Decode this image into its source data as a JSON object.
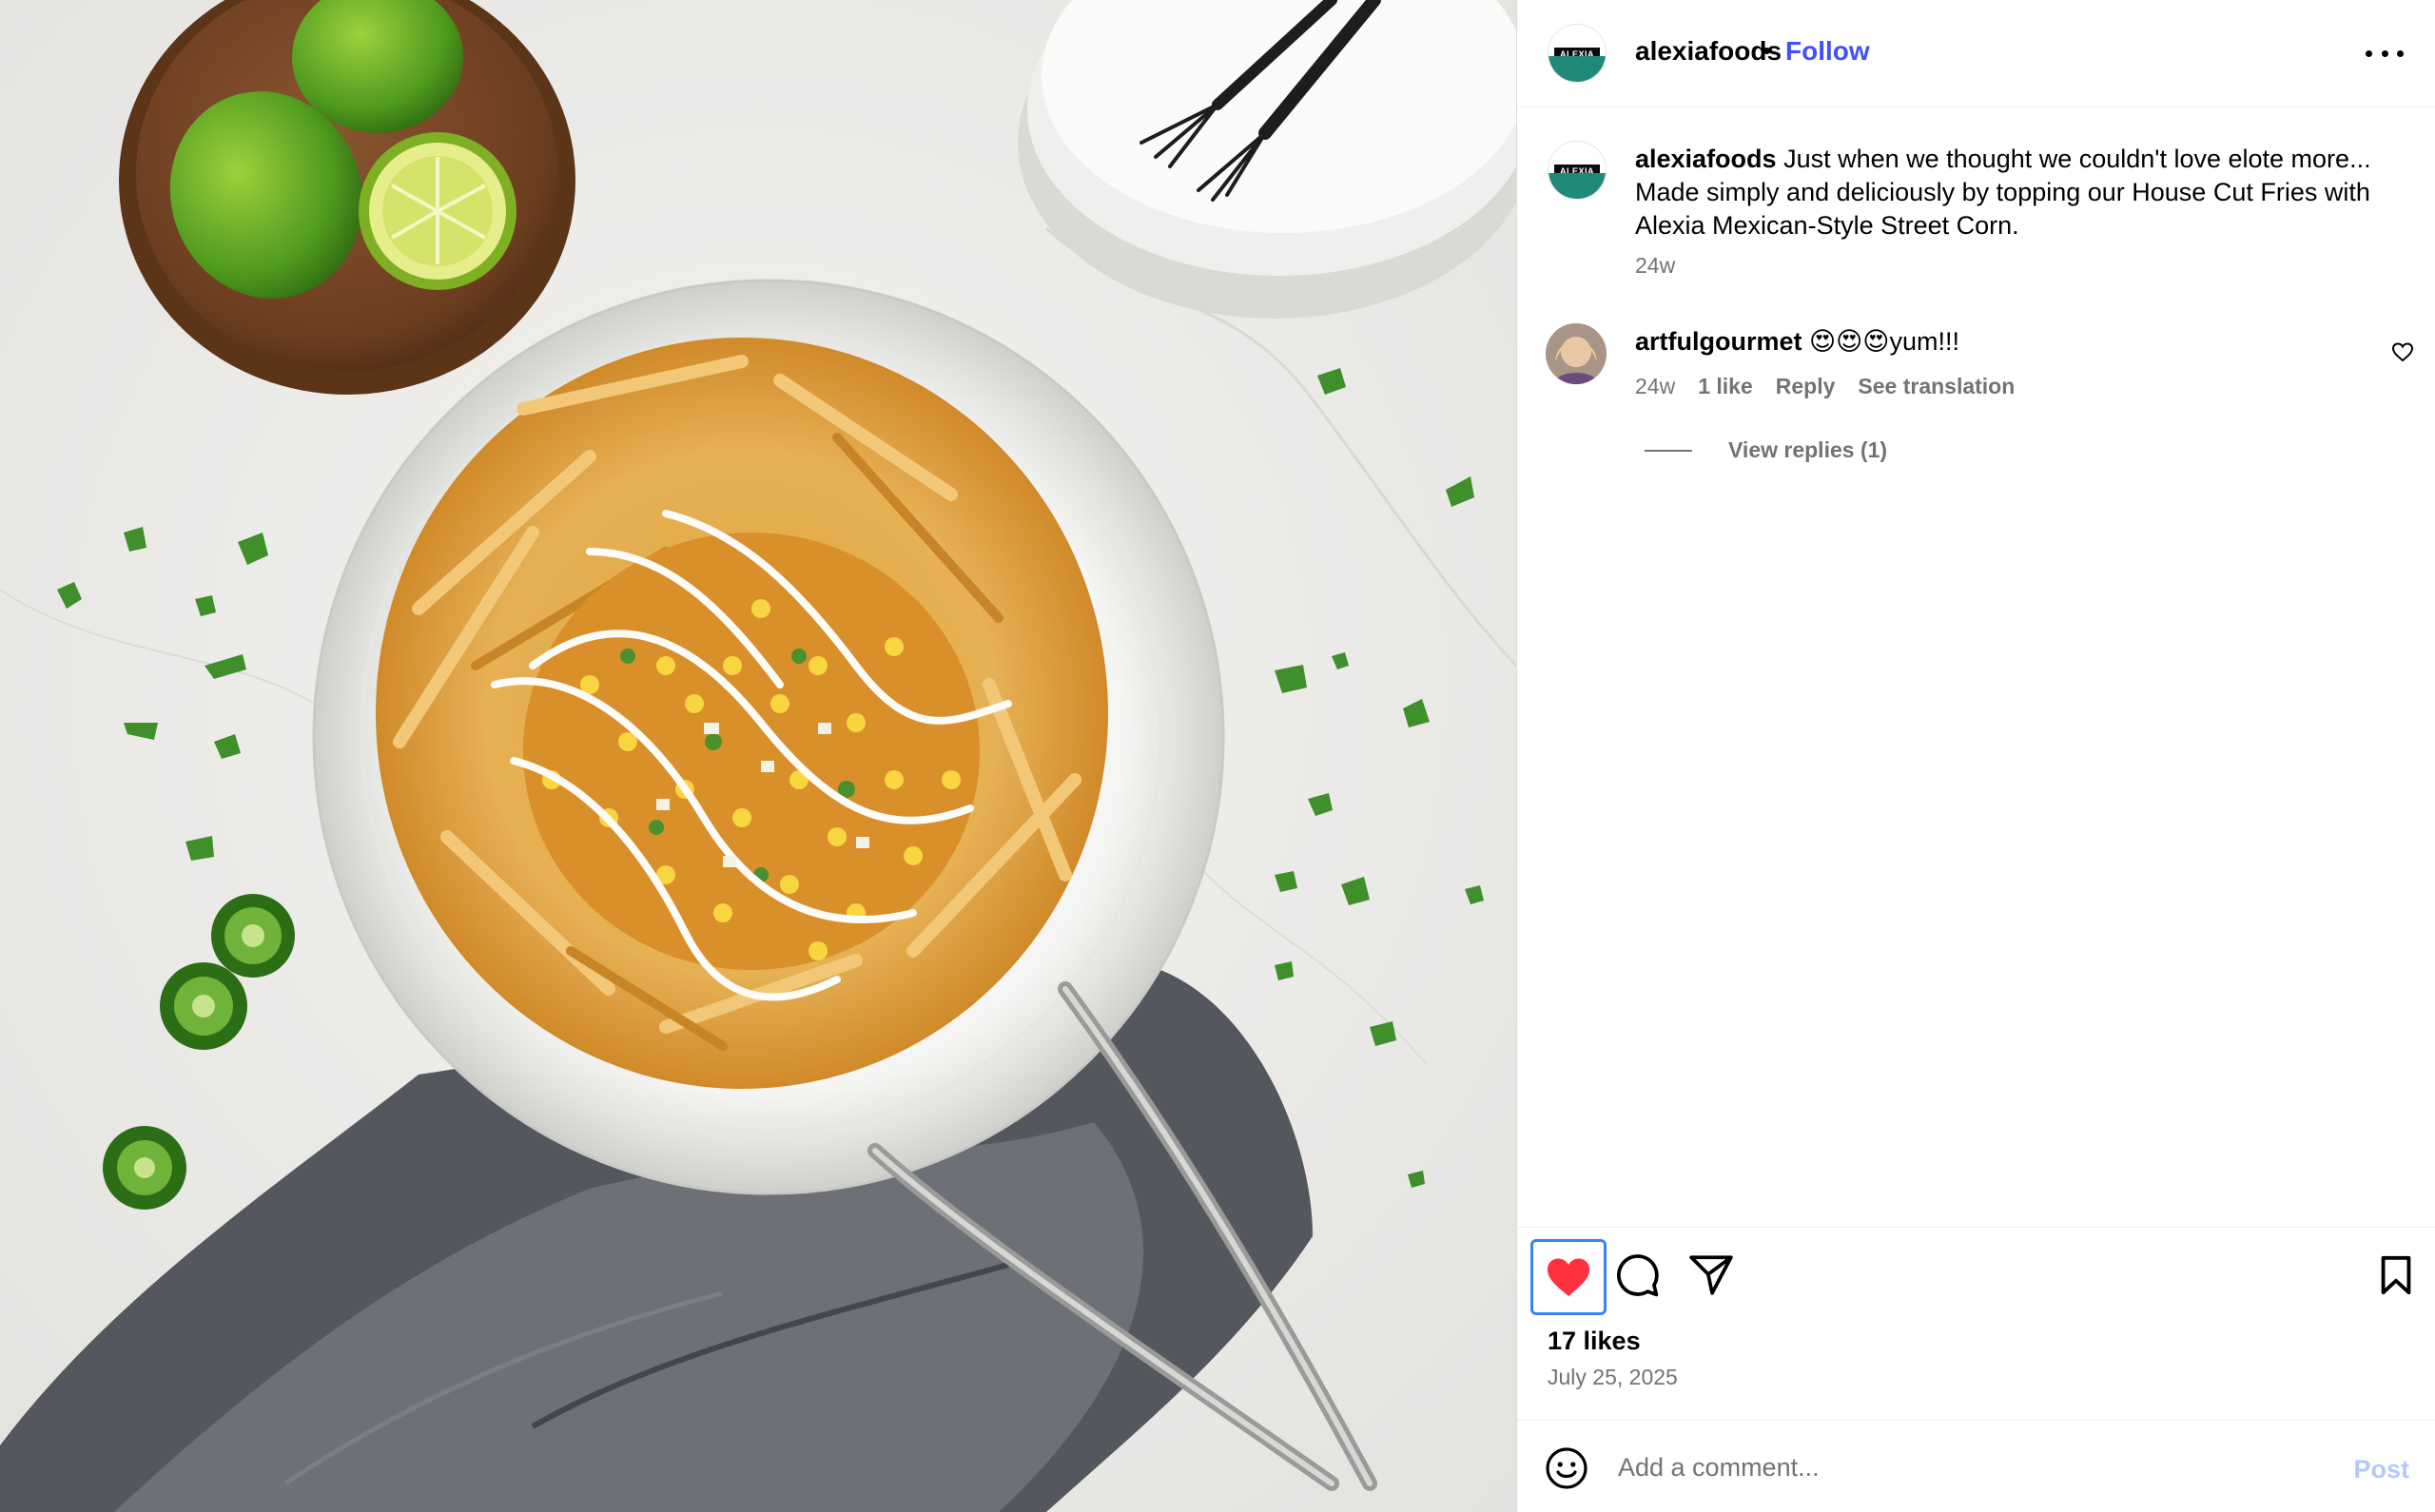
{
  "post": {
    "username": "alexiafoods",
    "separator": "•",
    "follow_label": "Follow",
    "avatar_label": "ALEXIA",
    "more_icon": "more-options-icon",
    "media_description_icon": "food-photo"
  },
  "caption": {
    "username": "alexiafoods",
    "text": " Just when we thought we couldn't love elote more... Made simply and deliciously by topping our House Cut Fries with Alexia Mexican-Style Street Corn.",
    "time": "24w"
  },
  "comments": [
    {
      "username": "artfulgourmet",
      "text": " 😍😍😍yum!!!",
      "time": "24w",
      "likes_label": "1 like",
      "reply_label": "Reply",
      "translate_label": "See translation",
      "view_replies_label": "View replies (1)"
    }
  ],
  "actions": {
    "liked": true,
    "like_color": "#ff3040",
    "likes_label": "17 likes",
    "date": "July 25, 2025"
  },
  "add_comment": {
    "placeholder": "Add a comment...",
    "post_label": "Post"
  },
  "colors": {
    "follow": "#4150f7",
    "muted": "#737373",
    "post_disabled": "#b3c9f7",
    "focus_ring": "#3b82f6"
  }
}
